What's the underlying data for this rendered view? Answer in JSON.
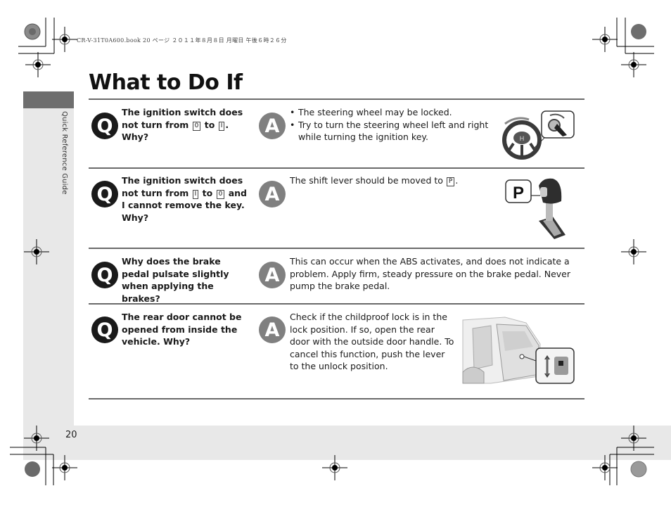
{
  "print_header": "CR-V-31T0A600.book  20 ページ  ２０１１年８月８日  月曜日  午後６時２６分",
  "side_label": "Quick Reference Guide",
  "title": "What to Do If",
  "page_number": "20",
  "badges": {
    "question": "Q",
    "answer": "A"
  },
  "faq": [
    {
      "question_parts": [
        "The ignition switch does not turn from ",
        "0",
        " to ",
        "I",
        ". Why?"
      ],
      "answer_bullets": [
        "The steering wheel may be locked.",
        "Try to turn the steering wheel left and right while turning the ignition key."
      ],
      "figure": "steering-wheel-ignition-illustration"
    },
    {
      "question_parts": [
        "The ignition switch does not turn from ",
        "I",
        " to ",
        "0",
        " and I cannot remove the key. Why?"
      ],
      "answer_parts": [
        "The shift lever should be moved to ",
        "P",
        "."
      ],
      "figure": "shift-lever-park-illustration",
      "figure_label": "P"
    },
    {
      "question": "Why does the brake pedal pulsate slightly when applying the brakes?",
      "answer": "This can occur when the ABS activates, and does not indicate a problem. Apply firm, steady pressure on the brake pedal. Never pump the brake pedal."
    },
    {
      "question": "The rear door cannot be opened from inside the vehicle. Why?",
      "answer": "Check if the childproof lock is in the lock position. If so, open the rear door with the outside door handle. To cancel this function, push the lever to the unlock position.",
      "figure": "rear-door-childproof-lock-illustration"
    }
  ],
  "colors": {
    "band_gray": "#e8e8e8",
    "tab_gray": "#6e6e6e",
    "rule_gray": "#6a6a6a",
    "q_badge": "#1a1a1a",
    "a_badge": "#808080"
  }
}
